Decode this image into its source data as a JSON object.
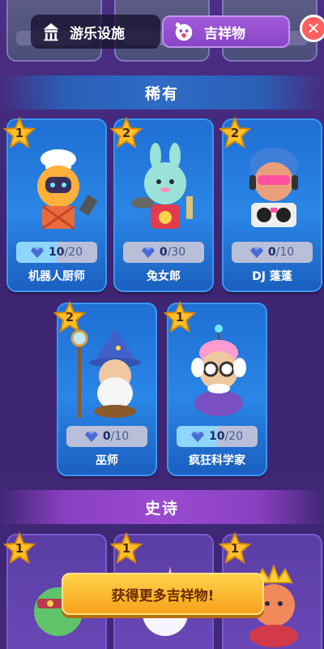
{
  "top_tabs": {
    "facilities_label": "游乐设施",
    "mascots_label": "吉祥物"
  },
  "sections": {
    "rare_title": "稀有",
    "epic_title": "史诗"
  },
  "rare_mascots": [
    {
      "level": "1",
      "name": "机器人厨师",
      "count": 10,
      "max": 20,
      "count_text": "10",
      "max_text": "/20",
      "progress": 0.5
    },
    {
      "level": "2",
      "name": "兔女郎",
      "count": 0,
      "max": 30,
      "count_text": "0",
      "max_text": "/30",
      "progress": 0.0
    },
    {
      "level": "2",
      "name": "DJ 蓬蓬",
      "count": 0,
      "max": 10,
      "count_text": "0",
      "max_text": "/10",
      "progress": 0.0
    },
    {
      "level": "2",
      "name": "巫师",
      "count": 0,
      "max": 10,
      "count_text": "0",
      "max_text": "/10",
      "progress": 0.0
    },
    {
      "level": "1",
      "name": "疯狂科学家",
      "count": 10,
      "max": 20,
      "count_text": "10",
      "max_text": "/20",
      "progress": 0.5
    }
  ],
  "epic_mascots": [
    {
      "level": "1"
    },
    {
      "level": "1"
    },
    {
      "level": "1"
    }
  ],
  "cta": {
    "label": "获得更多吉祥物!"
  },
  "colors": {
    "rare_card": "#2a86e6",
    "epic_header": "#9a4bd0",
    "cta": "#f7a21b",
    "close": "#ff5f5f"
  },
  "icons": {
    "facility": "amusement-park-icon",
    "mascot": "mascot-face-icon",
    "close": "close-icon",
    "gem": "gem-icon",
    "star": "star-icon"
  }
}
